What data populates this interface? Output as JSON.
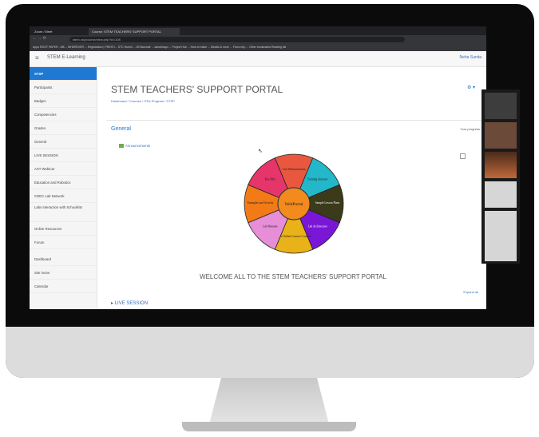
{
  "browser": {
    "tabs": [
      "Zoom / Meet",
      "Course: STEM TEACHERS' SUPPORT PORTAL"
    ],
    "url": "stem.org/course/view.php?id=108",
    "bookmarks": "Apps   ROOT PAPER - ME...   WHEREVER ...   Registration | FRESTI...   STC Hutchi ...   JB Barcode ...   sanubhayo ...   Project Hub ...   How to make ...   Details & more ...   Find a trip ...   Other bookmarks   Reading list"
  },
  "app": {
    "brand": "STEM E-Learning",
    "user": "Neha Sunita"
  },
  "sidebar": {
    "items": [
      {
        "label": "STSP",
        "active": true
      },
      {
        "label": "Participants"
      },
      {
        "label": "Badges"
      },
      {
        "label": "Competencies"
      },
      {
        "label": "Grades"
      },
      {
        "label": "General"
      },
      {
        "label": "LIVE SESSION"
      },
      {
        "label": "AST Webinar"
      },
      {
        "label": "Education and Robotics"
      },
      {
        "label": "CDEC Lab Network"
      },
      {
        "label": "Labs interaction with Schoolkits"
      },
      {
        "label": "Online Resources"
      },
      {
        "label": "Forum"
      },
      {
        "label": "Dashboard"
      },
      {
        "label": "Site home"
      },
      {
        "label": "Calendar"
      }
    ]
  },
  "main": {
    "title": "STEM TEACHERS' SUPPORT PORTAL",
    "breadcrumb": "Dashboard  /  Courses  /  ITRs Program  /  STSP",
    "section": "General",
    "progress": "Your progress",
    "announcement": "Announcements",
    "welcome": "WELCOME ALL TO THE STEM TEACHERS' SUPPORT PORTAL",
    "expand_all": "Expand all",
    "live_session": "LIVE SESSION"
  },
  "wheel": {
    "center": "WebPortal",
    "segments": [
      {
        "label": "Live Demonstration",
        "color": "#e9573f"
      },
      {
        "label": "Training Sessions",
        "color": "#23b7c9"
      },
      {
        "label": "Sample Lesson Plans",
        "color": "#3b3a1a"
      },
      {
        "label": "Lab Architecture",
        "color": "#7a17d6"
      },
      {
        "label": "Free Online Courses Content",
        "color": "#e8b218"
      },
      {
        "label": "Lab Manuals",
        "color": "#e68fd7"
      },
      {
        "label": "Examples and Activity",
        "color": "#f27b17"
      },
      {
        "label": "Kits Pdfs",
        "color": "#e6356a"
      }
    ]
  }
}
